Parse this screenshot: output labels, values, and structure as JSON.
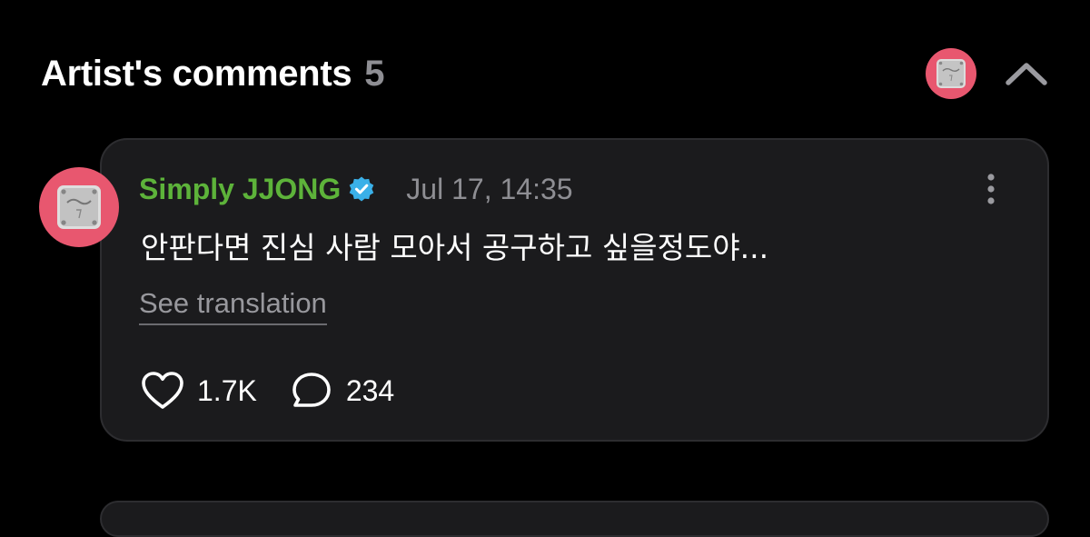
{
  "header": {
    "title": "Artist's comments",
    "count": "5"
  },
  "comment": {
    "author": "Simply JJONG",
    "timestamp": "Jul 17, 14:35",
    "text": "안판다면 진심 사람 모아서 공구하고 싶을정도야...",
    "see_translation": "See translation",
    "likes": "1.7K",
    "replies": "234"
  },
  "colors": {
    "background": "#000000",
    "card": "#1b1b1d",
    "author_green": "#5db33a",
    "verified_blue": "#3ab0e8",
    "avatar_pink": "#e8576f",
    "muted_text": "#8e8e93"
  },
  "icons": {
    "header_avatar": "guitar-neckplate-avatar",
    "collapse": "chevron-up-icon",
    "verified": "verified-badge-icon",
    "more": "more-vertical-icon",
    "like": "heart-icon",
    "reply": "comment-bubble-icon"
  }
}
